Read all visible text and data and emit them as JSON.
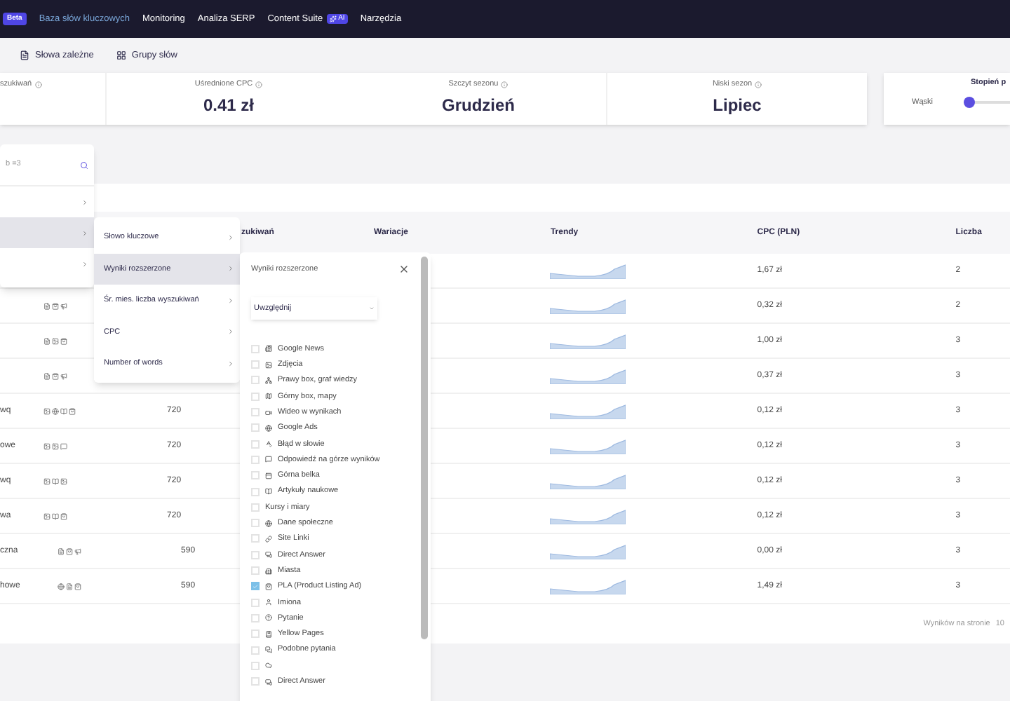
{
  "nav": {
    "badge": "Beta",
    "items": [
      {
        "label": "Baza słów kluczowych",
        "selected": true
      },
      {
        "label": "Monitoring",
        "selected": false
      },
      {
        "label": "Analiza SERP",
        "selected": false
      },
      {
        "label": "Content Suite",
        "selected": false,
        "badge": "AI"
      },
      {
        "label": "Narzędzia",
        "selected": false
      }
    ]
  },
  "toolbar": [
    "Słowa zależne",
    "Grupy słów"
  ],
  "stats": [
    {
      "label": "szukiwań"
    },
    {
      "label": "Uśrednione CPC",
      "value": "0.41 zł"
    },
    {
      "label": "Szczyt sezonu",
      "value": "Grudzień"
    },
    {
      "label": "Niski sezon",
      "value": "Lipiec"
    }
  ],
  "slider": {
    "title": "Stopień p",
    "label": "Wąski",
    "level": 0
  },
  "table": {
    "columns": [
      "",
      "zukiwań",
      "Wariacje",
      "Trendy",
      "CPC (PLN)",
      "Liczba"
    ],
    "rows": [
      {
        "keyword": "",
        "volume": "",
        "cpc": "1,67 zł",
        "count": "2"
      },
      {
        "keyword": "",
        "volume": "",
        "cpc": "0,32 zł",
        "count": "2"
      },
      {
        "keyword": "",
        "volume": "",
        "cpc": "1,00 zł",
        "count": "3"
      },
      {
        "keyword": "",
        "volume": "",
        "cpc": "0,37 zł",
        "count": "3"
      },
      {
        "keyword": "wq",
        "volume": "720",
        "cpc": "0,12 zł",
        "count": "3"
      },
      {
        "keyword": "owe",
        "volume": "720",
        "cpc": "0,12 zł",
        "count": "3"
      },
      {
        "keyword": "wq",
        "volume": "720",
        "cpc": "0,12 zł",
        "count": "3"
      },
      {
        "keyword": "wa",
        "volume": "720",
        "cpc": "0,12 zł",
        "count": "3"
      },
      {
        "keyword": "czna",
        "volume": "590",
        "cpc": "0,00 zł",
        "count": "3"
      },
      {
        "keyword": "howe",
        "volume": "590",
        "cpc": "1,49 zł",
        "count": "3"
      }
    ],
    "footer": {
      "label": "Wyników na stronie",
      "value": "10"
    }
  },
  "filter_menu": {
    "search": {
      "placeholder": "b =3"
    },
    "items": [
      {
        "selected": false
      },
      {
        "selected": true
      },
      {
        "selected": false
      }
    ]
  },
  "column_menu": {
    "items": [
      {
        "label": "Słowo kluczowe",
        "selected": false
      },
      {
        "label": "Wyniki rozszerzone",
        "selected": true
      },
      {
        "label": "Śr. mies. liczba wyszukiwań",
        "selected": false
      },
      {
        "label": "CPC",
        "selected": false
      },
      {
        "label": "Number of words",
        "selected": false
      }
    ]
  },
  "features_panel": {
    "title": "Wyniki rozszerzone",
    "mode": "Uwzględnij",
    "items": [
      {
        "label": "Google News",
        "checked": false
      },
      {
        "label": "Zdjęcia",
        "checked": false
      },
      {
        "label": "Prawy box, graf wiedzy",
        "checked": false
      },
      {
        "label": "Górny box, mapy",
        "checked": false
      },
      {
        "label": "Wideo w wynikach",
        "checked": false
      },
      {
        "label": "Google Ads",
        "checked": false
      },
      {
        "label": "Błąd w słowie",
        "checked": false
      },
      {
        "label": "Odpowiedź na górze wyników",
        "checked": false
      },
      {
        "label": "Górna belka",
        "checked": false
      },
      {
        "label": "Artykuły naukowe",
        "checked": false
      },
      {
        "label": "Kursy i miary",
        "checked": false
      },
      {
        "label": "Dane społeczne",
        "checked": false
      },
      {
        "label": "Site Linki",
        "checked": false
      },
      {
        "label": "Direct Answer",
        "checked": false
      },
      {
        "label": "Miasta",
        "checked": false
      },
      {
        "label": "PLA (Product Listing Ad)",
        "checked": true
      },
      {
        "label": "Imiona",
        "checked": false
      },
      {
        "label": "Pytanie",
        "checked": false
      },
      {
        "label": "Yellow Pages",
        "checked": false
      },
      {
        "label": "Podobne pytania",
        "checked": false
      },
      {
        "checked": false
      },
      {
        "label": "Direct Answer",
        "checked": false
      }
    ]
  }
}
